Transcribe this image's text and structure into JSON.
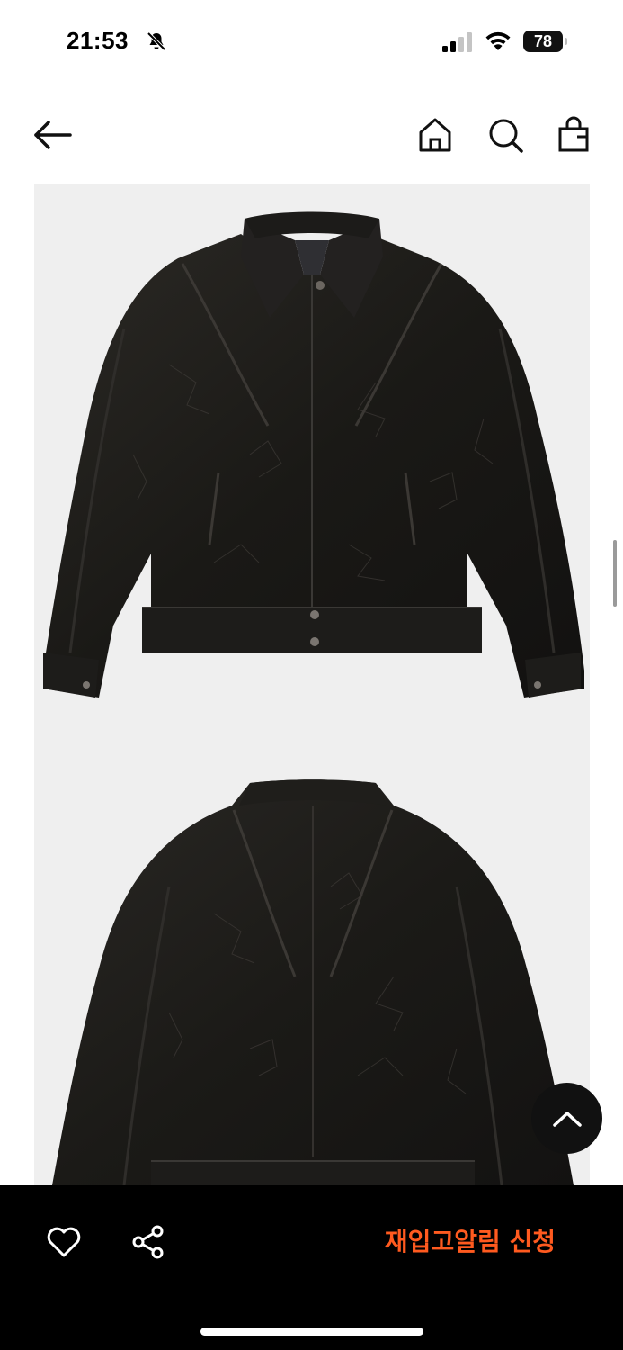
{
  "status_bar": {
    "time": "21:53",
    "battery": "78"
  },
  "header": {
    "back_icon": "arrow-left-icon",
    "home_icon": "home-icon",
    "search_icon": "search-icon",
    "bag_icon": "shopping-bag-icon"
  },
  "product": {
    "images": [
      "jacket-front-image",
      "jacket-back-image"
    ]
  },
  "actions": {
    "like_icon": "heart-icon",
    "share_icon": "share-icon",
    "restock_label": "재입고알림 신청",
    "top_icon": "chevron-up-icon"
  },
  "colors": {
    "accent": "#ff5a1f",
    "bottom_bar": "#000000"
  }
}
